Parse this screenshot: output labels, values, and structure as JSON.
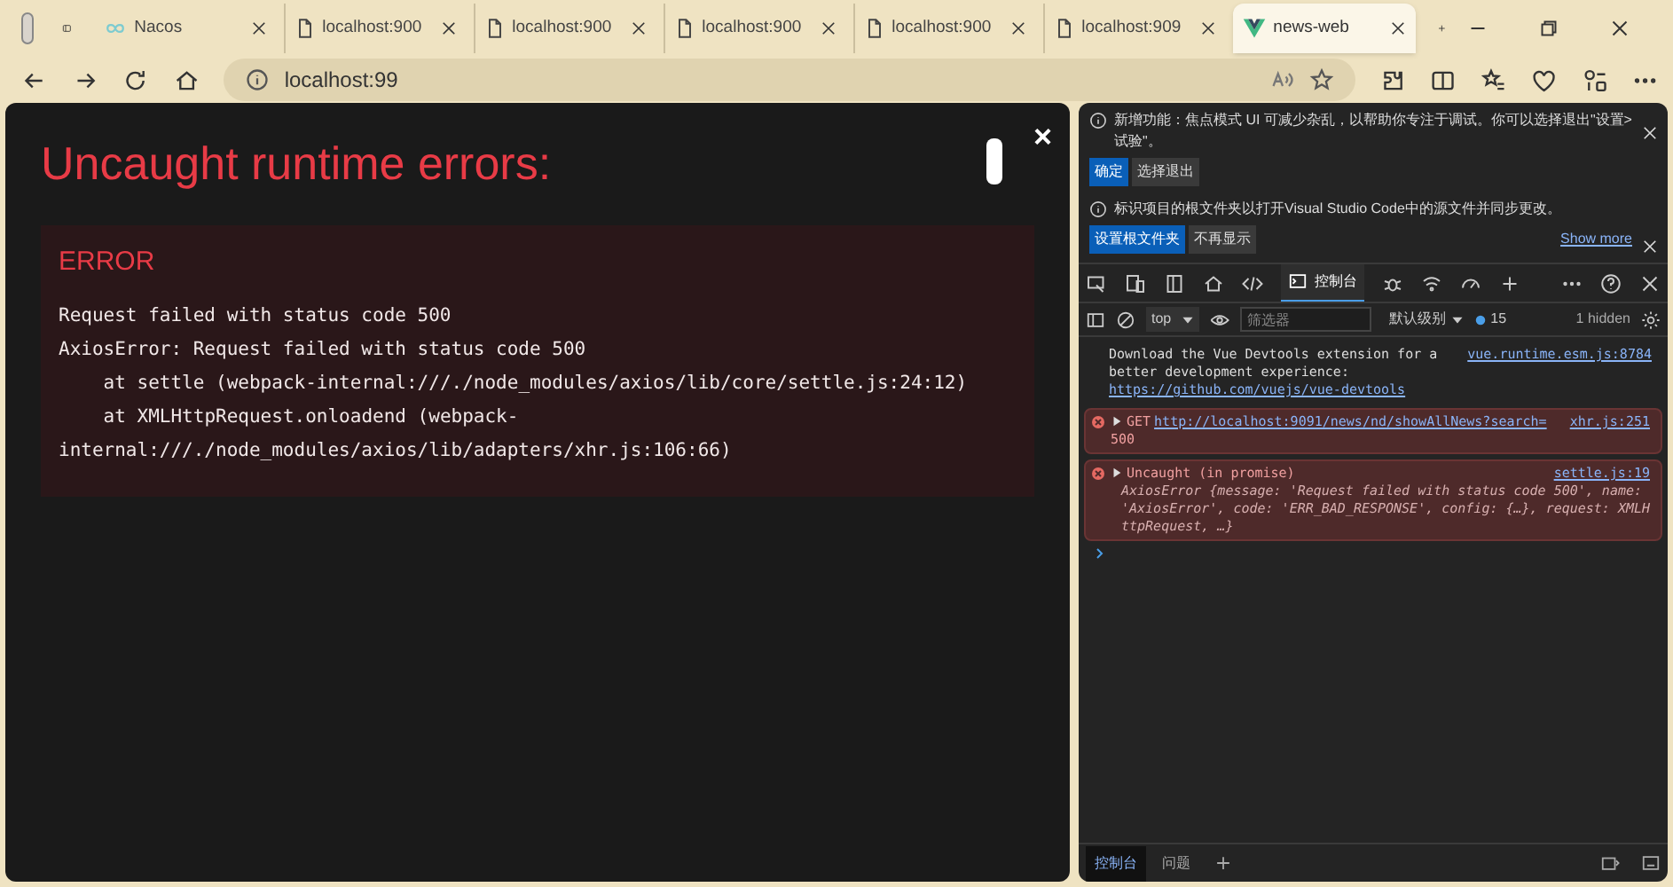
{
  "browser": {
    "tabs": [
      {
        "label": "Nacos",
        "kind": "infinity",
        "selected": false
      },
      {
        "label": "localhost:900",
        "kind": "page",
        "selected": false
      },
      {
        "label": "localhost:900",
        "kind": "page",
        "selected": false
      },
      {
        "label": "localhost:900",
        "kind": "page",
        "selected": false
      },
      {
        "label": "localhost:900",
        "kind": "page",
        "selected": false
      },
      {
        "label": "localhost:909",
        "kind": "page",
        "selected": false
      },
      {
        "label": "news-web",
        "kind": "vue",
        "selected": true
      }
    ],
    "address": "localhost:99"
  },
  "overlay": {
    "title": "Uncaught runtime errors:",
    "close": "×",
    "error": {
      "heading": "ERROR",
      "lines": [
        "Request failed with status code 500",
        "AxiosError: Request failed with status code 500",
        "    at settle (webpack-internal:///./node_modules/axios/lib/core/settle.js:24:12)",
        "    at XMLHttpRequest.onloadend (webpack-internal:///./node_modules/axios/lib/adapters/xhr.js:106:66)"
      ]
    }
  },
  "devtools": {
    "notices": [
      {
        "text": "新增功能：焦点模式 UI 可减少杂乱，以帮助你专注于调试。你可以选择退出\"设置>试验\"。",
        "buttons": [
          {
            "label": "确定",
            "primary": true
          },
          {
            "label": "选择退出",
            "primary": false
          }
        ]
      },
      {
        "text": "标识项目的根文件夹以打开Visual Studio Code中的源文件并同步更改。",
        "link": "Show more",
        "buttons": [
          {
            "label": "设置根文件夹",
            "primary": true
          },
          {
            "label": "不再显示",
            "primary": false
          }
        ]
      }
    ],
    "toolbar_tabs": [
      {
        "label": "控制台",
        "selected": true
      }
    ],
    "console_bar": {
      "context": "top",
      "filter_placeholder": "筛选器",
      "levels": "默认级别",
      "issues": "15",
      "hidden": "1 hidden"
    },
    "messages": [
      {
        "kind": "info",
        "text": "Download the Vue Devtools extension for a better development experience:",
        "link": "https://github.com/vuejs/vue-devtools",
        "source": "vue.runtime.esm.js:8784"
      },
      {
        "kind": "error",
        "prefix": "GET",
        "url": "http://localhost:9091/news/nd/showAllNews?search=",
        "detail": "500",
        "source": "xhr.js:251"
      },
      {
        "kind": "error",
        "prefix": "Uncaught (in promise)",
        "detail": "AxiosError {message: 'Request failed with status code 500', name: 'AxiosError', code: 'ERR_BAD_RESPONSE', config: {…}, request: XMLHttpRequest, …}",
        "source": "settle.js:19"
      }
    ],
    "drawer_tabs": [
      {
        "label": "控制台",
        "selected": true
      },
      {
        "label": "问题",
        "selected": false
      }
    ]
  }
}
